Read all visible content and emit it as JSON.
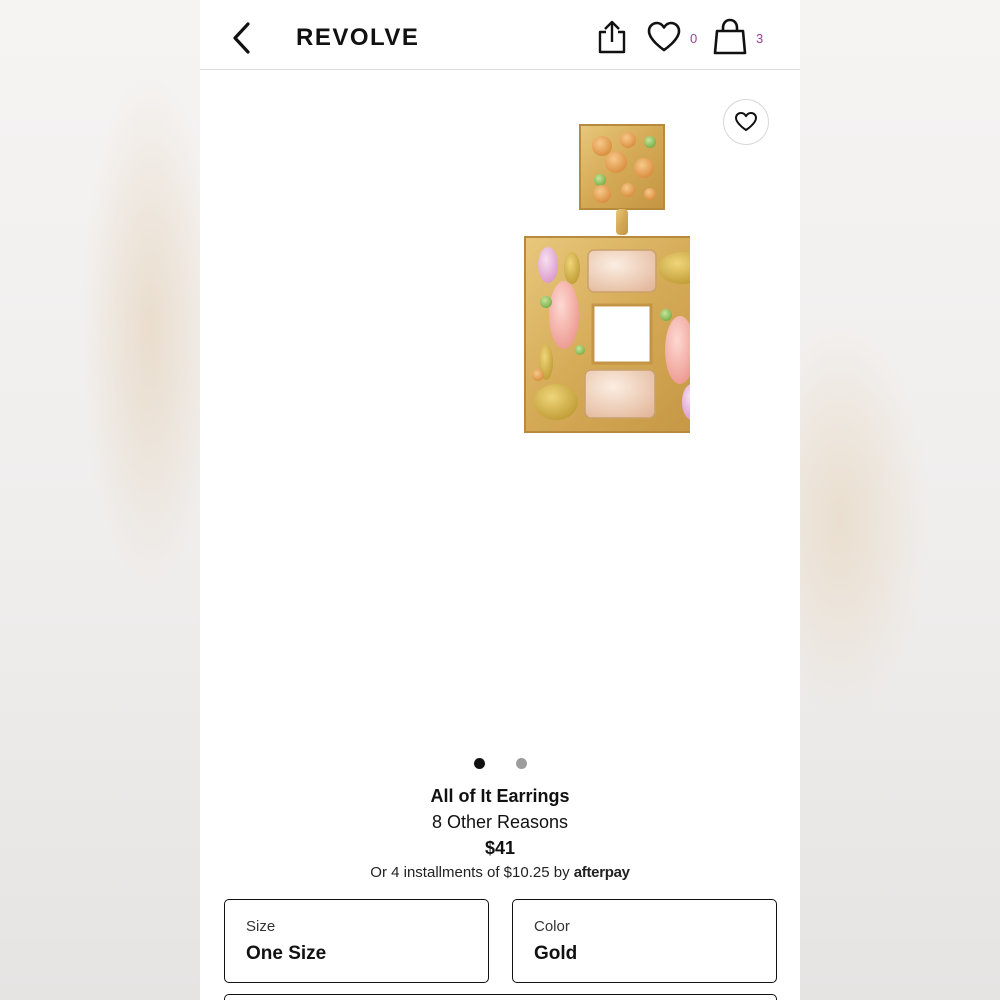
{
  "header": {
    "logo": "REVOLVE",
    "wishlist_count": "0",
    "bag_count": "3"
  },
  "icons": {
    "back": "chevron-left-icon",
    "share": "share-icon",
    "wishlist": "heart-icon",
    "bag": "shopping-bag-icon",
    "favorite": "heart-icon"
  },
  "gallery": {
    "image_count": 2,
    "active_index": 0
  },
  "product": {
    "name": "All of It Earrings",
    "brand": "8 Other Reasons",
    "price": "$41",
    "installments_text": "Or 4 installments of $10.25 by ",
    "installments_provider": "afterpay"
  },
  "options": {
    "size_label": "Size",
    "size_value": "One Size",
    "color_label": "Color",
    "color_value": "Gold"
  },
  "colors": {
    "accent_count": "#9a3f9a",
    "text": "#111111"
  }
}
